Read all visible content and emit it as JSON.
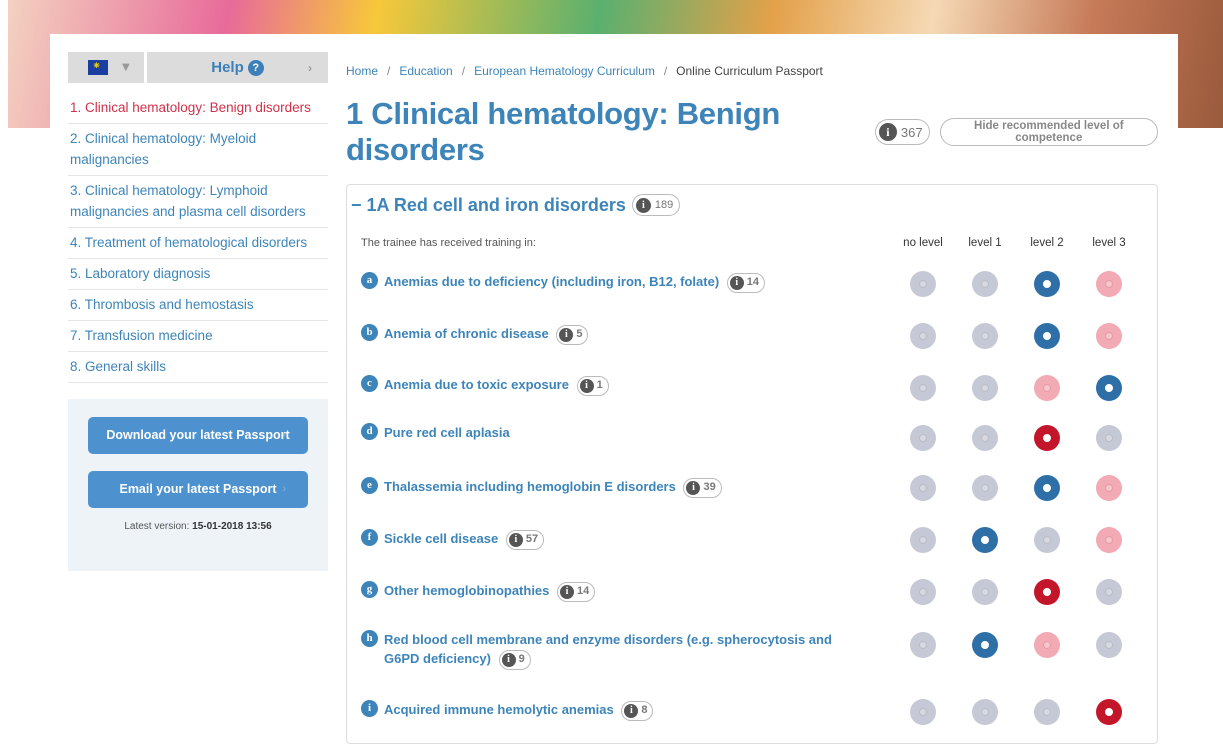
{
  "sidebar": {
    "help_label": "Help",
    "nav": [
      "1. Clinical hematology: Benign disorders",
      "2. Clinical hematology: Myeloid malignancies",
      "3. Clinical hematology: Lymphoid malignancies and plasma cell disorders",
      "4. Treatment of hematological disorders",
      "5. Laboratory diagnosis",
      "6. Thrombosis and hemostasis",
      "7. Transfusion medicine",
      "8. General skills"
    ],
    "download_label": "Download your latest Passport",
    "email_label": "Email your latest Passport",
    "latest_label": "Latest version:",
    "latest_value": "15-01-2018 13:56"
  },
  "breadcrumb": [
    "Home",
    "Education",
    "European Hematology Curriculum",
    "Online Curriculum Passport"
  ],
  "page": {
    "title": "1 Clinical hematology: Benign disorders",
    "count": "367",
    "hide_label": "Hide recommended level of competence"
  },
  "section": {
    "title": "− 1A Red cell and iron disorders",
    "count": "189",
    "intro": "The trainee has received training in:",
    "columns": [
      "no level",
      "level 1",
      "level 2",
      "level 3"
    ]
  },
  "colors": {
    "accent": "#3d84b9",
    "active_nav": "#d0314a",
    "selected_blue": "#2f6fa8",
    "selected_red": "#c4162b",
    "recommended_pink": "#f2aab4"
  },
  "rows": [
    {
      "letter": "a",
      "label": "Anemias due to deficiency (including iron, B12, folate)",
      "count": "14",
      "states": [
        "gray",
        "gray",
        "blue",
        "pink"
      ]
    },
    {
      "letter": "b",
      "label": "Anemia of chronic disease",
      "count": "5",
      "states": [
        "gray",
        "gray",
        "blue",
        "pink"
      ]
    },
    {
      "letter": "c",
      "label": "Anemia due to toxic exposure",
      "count": "1",
      "states": [
        "gray",
        "gray",
        "pink",
        "blue"
      ]
    },
    {
      "letter": "d",
      "label": "Pure red cell aplasia",
      "count": "",
      "states": [
        "gray",
        "gray",
        "red",
        "gray"
      ]
    },
    {
      "letter": "e",
      "label": "Thalassemia including hemoglobin E disorders",
      "count": "39",
      "states": [
        "gray",
        "gray",
        "blue",
        "pink"
      ]
    },
    {
      "letter": "f",
      "label": "Sickle cell disease",
      "count": "57",
      "states": [
        "gray",
        "blue",
        "gray",
        "pink"
      ]
    },
    {
      "letter": "g",
      "label": "Other hemoglobinopathies",
      "count": "14",
      "states": [
        "gray",
        "gray",
        "red",
        "gray"
      ]
    },
    {
      "letter": "h",
      "label": "Red blood cell membrane and enzyme disorders (e.g. spherocytosis and G6PD deficiency)",
      "count": "9",
      "states": [
        "gray",
        "blue",
        "pink",
        "gray"
      ]
    },
    {
      "letter": "i",
      "label": "Acquired immune hemolytic anemias",
      "count": "8",
      "states": [
        "gray",
        "gray",
        "gray",
        "red"
      ]
    }
  ]
}
